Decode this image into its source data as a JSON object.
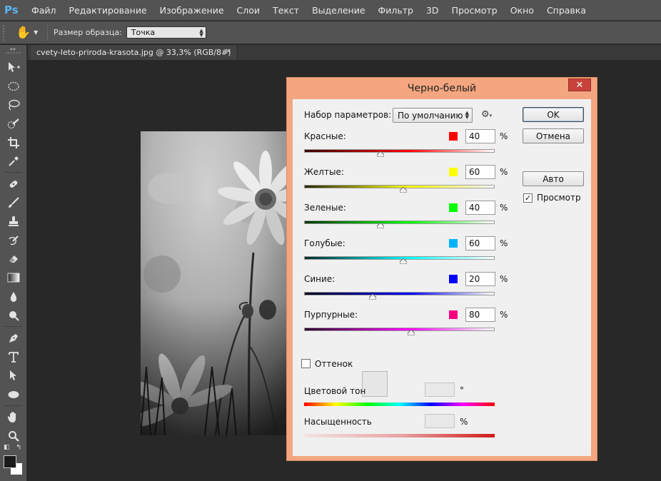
{
  "app": {
    "logo": "Ps",
    "menu": [
      "Файл",
      "Редактирование",
      "Изображение",
      "Слои",
      "Текст",
      "Выделение",
      "Фильтр",
      "3D",
      "Просмотр",
      "Окно",
      "Справка"
    ]
  },
  "options": {
    "sample_size_label": "Размер образца:",
    "sample_size_value": "Точка"
  },
  "document": {
    "tab_title": "cvety-leto-priroda-krasota.jpg @ 33,3% (RGB/8#)",
    "close_glyph": "✕"
  },
  "dialog": {
    "title": "Черно-белый",
    "close_glyph": "✕",
    "preset_label": "Набор параметров:",
    "preset_value": "По умолчанию",
    "buttons": {
      "ok": "OK",
      "cancel": "Отмена",
      "auto": "Авто"
    },
    "preview_label": "Просмотр",
    "preview_checked": true,
    "percent_sign": "%",
    "sliders": [
      {
        "label": "Красные:",
        "value": "40",
        "fraction": 0.4,
        "color": "#ff0000",
        "gradient": [
          "#3a0000",
          "#ff0000",
          "#ffffff"
        ]
      },
      {
        "label": "Желтые:",
        "value": "60",
        "fraction": 0.52,
        "color": "#ffff00",
        "gradient": [
          "#262600",
          "#ffff00",
          "#ffffff"
        ]
      },
      {
        "label": "Зеленые:",
        "value": "40",
        "fraction": 0.4,
        "color": "#00ff00",
        "gradient": [
          "#003300",
          "#00ff00",
          "#ffffff"
        ]
      },
      {
        "label": "Голубые:",
        "value": "60",
        "fraction": 0.52,
        "color": "#00b4ff",
        "gradient": [
          "#002a2a",
          "#00ffff",
          "#ffffff"
        ]
      },
      {
        "label": "Синие:",
        "value": "20",
        "fraction": 0.36,
        "color": "#0000ff",
        "gradient": [
          "#00001a",
          "#0000ff",
          "#ffffff"
        ]
      },
      {
        "label": "Пурпурные:",
        "value": "80",
        "fraction": 0.56,
        "color": "#ff0080",
        "gradient": [
          "#2a002a",
          "#ff00ff",
          "#ffffff"
        ]
      }
    ],
    "tint": {
      "label": "Оттенок",
      "checked": false,
      "hue_label": "Цветовой тон",
      "hue_unit": "°",
      "saturation_label": "Насыщенность",
      "saturation_unit": "%"
    }
  },
  "colors": {
    "dialog_frame": "#f3a67f",
    "ui_dark": "#535353",
    "canvas_bg": "#282828"
  }
}
